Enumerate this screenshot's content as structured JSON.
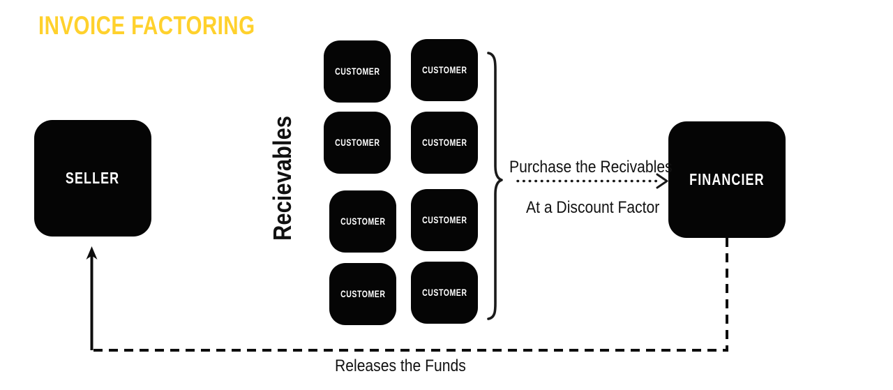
{
  "page": {
    "title": "INVOICE FACTORING",
    "background_color": "#ffffff",
    "accent_color": "#FFD12D",
    "node_color": "#050505",
    "text_color": "#111111"
  },
  "nodes": {
    "seller": {
      "label": "SELLER"
    },
    "financier": {
      "label": "FINANCIER"
    },
    "customers": [
      {
        "label": "CUSTOMER"
      },
      {
        "label": "CUSTOMER"
      },
      {
        "label": "CUSTOMER"
      },
      {
        "label": "CUSTOMER"
      },
      {
        "label": "CUSTOMER"
      },
      {
        "label": "CUSTOMER"
      },
      {
        "label": "CUSTOMER"
      },
      {
        "label": "CUSTOMER"
      }
    ]
  },
  "labels": {
    "receivables": "Recievables",
    "purchase_line": "Purchase the Recivables",
    "discount_line": "At a Discount Factor",
    "releases_funds": "Releases the Funds"
  },
  "connectors": {
    "brace": "curly-brace-right",
    "purchase_arrow": "dotted-arrow-right",
    "funds_arrow": "dashed-arrow-left-up"
  }
}
